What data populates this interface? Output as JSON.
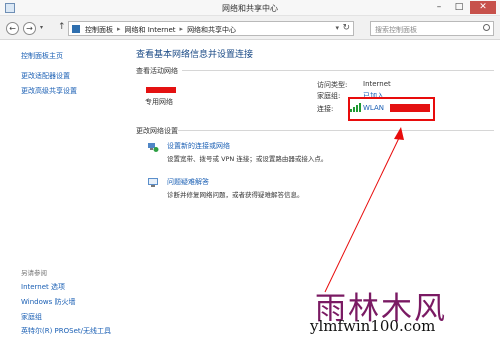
{
  "window": {
    "title": "网络和共享中心"
  },
  "address": {
    "breadcrumbs": [
      "控制面板",
      "网络和 Internet",
      "网络和共享中心"
    ],
    "search_placeholder": "搜索控制面板"
  },
  "sidebar": {
    "items": [
      {
        "label": "控制面板主页"
      },
      {
        "label": "更改适配器设置"
      },
      {
        "label": "更改高级共享设置"
      }
    ],
    "see_also_title": "另请参阅",
    "see_also": [
      {
        "label": "Internet 选项"
      },
      {
        "label": "Windows 防火墙"
      },
      {
        "label": "家庭组"
      },
      {
        "label": "英特尔(R) PROSet/无线工具"
      }
    ]
  },
  "main": {
    "title": "查看基本网络信息并设置连接",
    "active_section": "查看活动网络",
    "network_type": "专用网络",
    "access_type_label": "访问类型:",
    "access_type_value": "Internet",
    "homegroup_label": "家庭组:",
    "homegroup_value": "已加入",
    "connection_label": "连接:",
    "connection_value": "WLAN",
    "change_section": "更改网络设置",
    "tasks": [
      {
        "link": "设置新的连接或网络",
        "desc": "设置宽带、拨号或 VPN 连接；或设置路由器或接入点。"
      },
      {
        "link": "问题疑难解答",
        "desc": "诊断并修复网络问题，或者获得疑难解答信息。"
      }
    ]
  },
  "watermark": {
    "text": "雨林木风",
    "url": "ylmfwin100.com"
  },
  "colors": {
    "link": "#1a5fb4",
    "title": "#1a4a86",
    "redaction": "#e41111",
    "annotation": "#e80c0c",
    "watermark": "#7a1a63"
  }
}
